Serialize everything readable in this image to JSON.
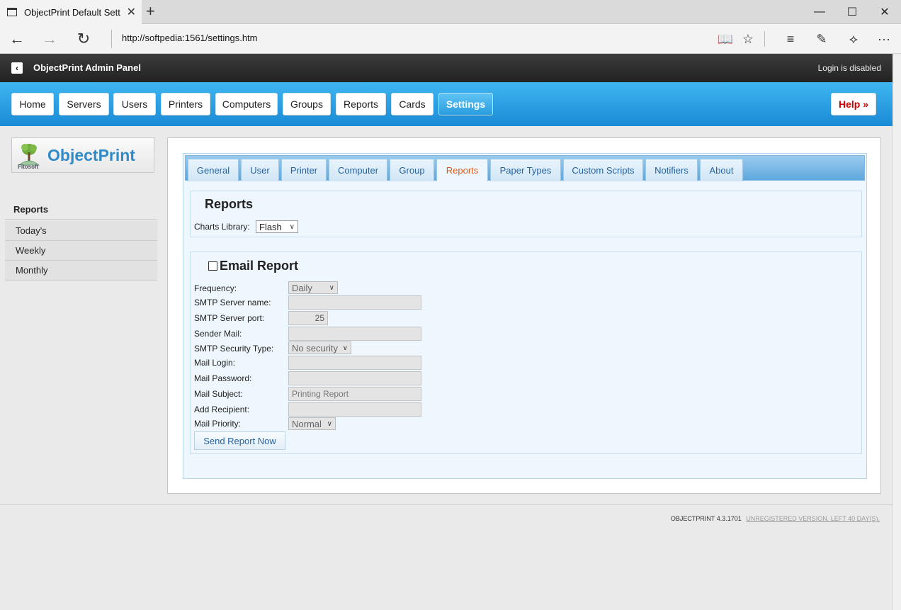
{
  "browser": {
    "tab_title": "ObjectPrint Default Sett",
    "url": "http://softpedia:1561/settings.htm"
  },
  "app": {
    "title": "ObjectPrint Admin Panel",
    "login_status": "Login is disabled"
  },
  "nav": {
    "items": [
      "Home",
      "Servers",
      "Users",
      "Printers",
      "Computers",
      "Groups",
      "Reports",
      "Cards",
      "Settings"
    ],
    "active": "Settings",
    "help": "Help »"
  },
  "logo": {
    "brand": "ObjectPrint",
    "sub": "Fitosoft"
  },
  "sidebar": {
    "heading": "Reports",
    "items": [
      "Today's",
      "Weekly",
      "Monthly"
    ]
  },
  "tabs": {
    "items": [
      "General",
      "User",
      "Printer",
      "Computer",
      "Group",
      "Reports",
      "Paper Types",
      "Custom Scripts",
      "Notifiers",
      "About"
    ],
    "active": "Reports"
  },
  "reports_section": {
    "title": "Reports",
    "charts_library_label": "Charts Library:",
    "charts_library_value": "Flash"
  },
  "email_section": {
    "title": "Email Report",
    "checked": false,
    "fields": {
      "frequency_label": "Frequency:",
      "frequency_value": "Daily",
      "smtp_server_label": "SMTP Server name:",
      "smtp_server_value": "",
      "smtp_port_label": "SMTP Server port:",
      "smtp_port_value": "25",
      "sender_label": "Sender Mail:",
      "sender_value": "",
      "security_label": "SMTP Security Type:",
      "security_value": "No security",
      "login_label": "Mail Login:",
      "login_value": "",
      "password_label": "Mail Password:",
      "password_value": "",
      "subject_label": "Mail Subject:",
      "subject_value": "Printing Report",
      "recipient_label": "Add Recipient:",
      "recipient_value": "",
      "priority_label": "Mail Priority:",
      "priority_value": "Normal"
    },
    "send_button": "Send Report Now"
  },
  "footer": {
    "version": "OBJECTPRINT 4.3.1701",
    "unregistered": "UNREGISTERED VERSION. LEFT 40 DAY(S)."
  },
  "colors": {
    "nav_gradient_top": "#3fb6f0",
    "nav_gradient_bottom": "#1a8ad6",
    "active_tab_text": "#d95a1b",
    "help_text": "#d00000"
  }
}
